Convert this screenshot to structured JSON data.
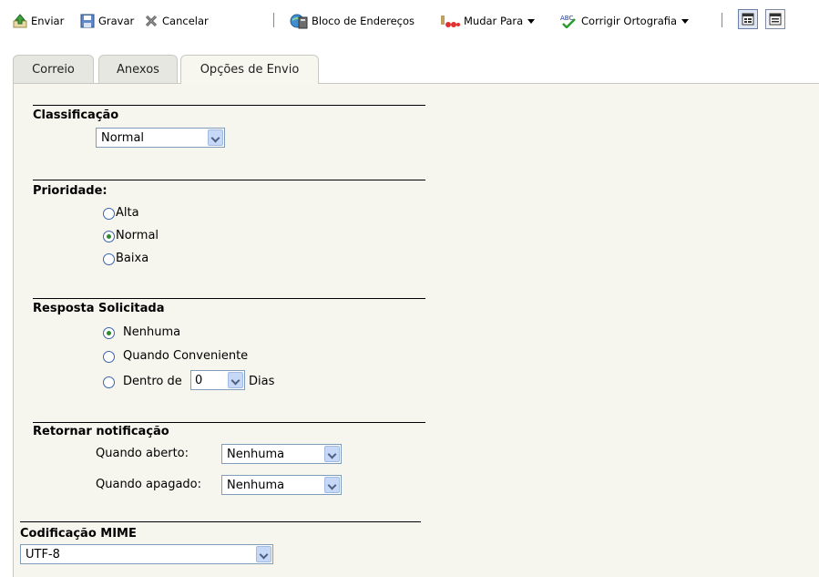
{
  "toolbar": {
    "send_label": "Enviar",
    "save_label": "Gravar",
    "cancel_label": "Cancelar",
    "address_book_label": "Bloco de Endereços",
    "change_to_label": "Mudar Para",
    "spell_check_label": "Corrigir Ortografia",
    "spell_check_icon_text": "ABC"
  },
  "tabs": [
    {
      "label": "Correio"
    },
    {
      "label": "Anexos"
    },
    {
      "label": "Opções de Envio"
    }
  ],
  "classification": {
    "heading": "Classificação",
    "selected": "Normal"
  },
  "priority": {
    "heading": "Prioridade:",
    "options": [
      {
        "label": "Alta",
        "checked": false
      },
      {
        "label": "Normal",
        "checked": true
      },
      {
        "label": "Baixa",
        "checked": false
      }
    ]
  },
  "reply_requested": {
    "heading": "Resposta Solicitada",
    "options": [
      {
        "label": "Nenhuma",
        "checked": true
      },
      {
        "label": "Quando Conveniente",
        "checked": false
      },
      {
        "label": "Dentro de",
        "checked": false
      }
    ],
    "days_value": "0",
    "days_label": "Dias"
  },
  "return_notification": {
    "heading": "Retornar notificação",
    "when_opened_label": "Quando aberto:",
    "when_opened_value": "Nenhuma",
    "when_deleted_label": "Quando apagado:",
    "when_deleted_value": "Nenhuma"
  },
  "mime": {
    "heading": "Codificação MIME",
    "selected": "UTF-8"
  }
}
